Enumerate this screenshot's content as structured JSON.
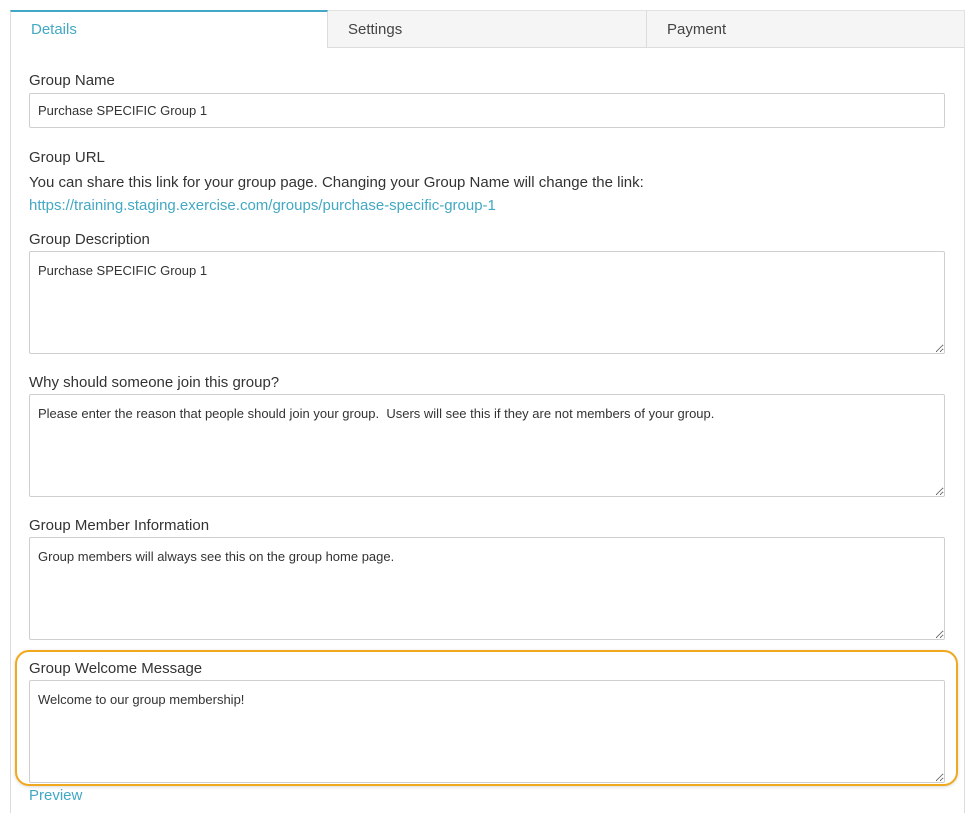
{
  "tabs": [
    {
      "label": "Details",
      "active": true
    },
    {
      "label": "Settings",
      "active": false
    },
    {
      "label": "Payment",
      "active": false
    }
  ],
  "form": {
    "group_name": {
      "label": "Group Name",
      "value": "Purchase SPECIFIC Group 1"
    },
    "group_url": {
      "label": "Group URL",
      "help": "You can share this link for your group page. Changing your Group Name will change the link:",
      "link": "https://training.staging.exercise.com/groups/purchase-specific-group-1"
    },
    "group_description": {
      "label": "Group Description",
      "value": "Purchase SPECIFIC Group 1"
    },
    "why_join": {
      "label": "Why should someone join this group?",
      "value": "Please enter the reason that people should join your group.  Users will see this if they are not members of your group."
    },
    "member_info": {
      "label": "Group Member Information",
      "value": "Group members will always see this on the group home page."
    },
    "welcome_message": {
      "label": "Group Welcome Message",
      "value": "Welcome to our group membership!"
    },
    "preview_label": "Preview"
  },
  "colors": {
    "accent": "#43a8c4",
    "highlight": "#f0a81c"
  }
}
